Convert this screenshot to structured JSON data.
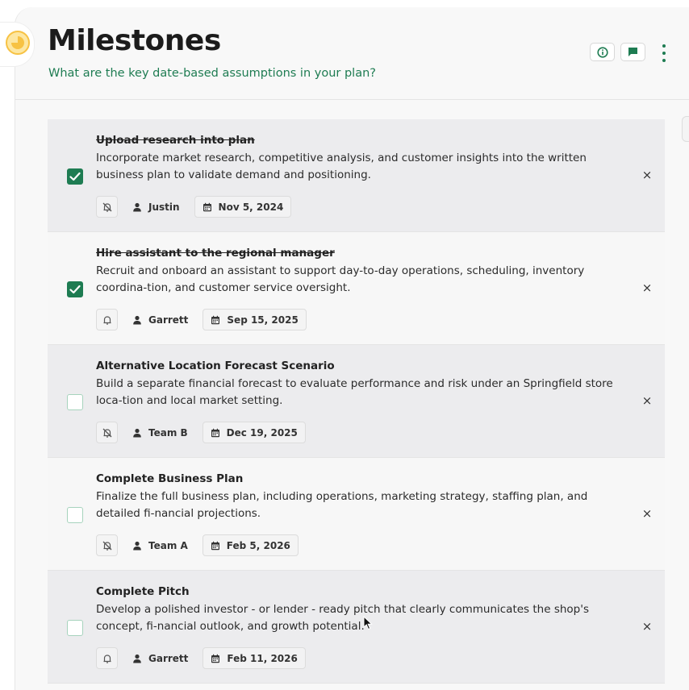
{
  "header": {
    "title": "Milestones",
    "subtitle": "What are the key date-based assumptions in your plan?",
    "info_icon": "info-icon",
    "comment_icon": "comment-icon",
    "menu_icon": "more-vertical-icon",
    "accent_color": "#1e7c52"
  },
  "milestones": [
    {
      "title": "Upload research into plan",
      "description": "Incorporate market research, competitive analysis, and customer insights into the written business plan to validate demand and positioning.",
      "completed": true,
      "reminder": "off",
      "assignee": "Justin",
      "date": "Nov 5, 2024"
    },
    {
      "title": "Hire assistant to the regional manager",
      "description": "Recruit and onboard an assistant to support day-to-day operations, scheduling, inventory coordina-tion, and customer service oversight.",
      "completed": true,
      "reminder": "on",
      "assignee": "Garrett",
      "date": "Sep 15, 2025"
    },
    {
      "title": "Alternative Location Forecast Scenario",
      "description": "Build a separate financial forecast to evaluate performance and risk under an Springfield store loca-tion and local market setting.",
      "completed": false,
      "reminder": "off",
      "assignee": "Team B",
      "date": "Dec 19, 2025"
    },
    {
      "title": "Complete Business Plan",
      "description": "Finalize the full business plan, including operations, marketing strategy, staffing plan, and detailed fi-nancial projections.",
      "completed": false,
      "reminder": "off",
      "assignee": "Team A",
      "date": "Feb 5, 2026"
    },
    {
      "title": "Complete Pitch",
      "description": "Develop a polished investor - or lender - ready pitch that clearly communicates the shop's concept, fi-nancial outlook, and growth potential.",
      "completed": false,
      "reminder": "on",
      "assignee": "Garrett",
      "date": "Feb 11, 2026"
    }
  ],
  "remove_symbol": "×"
}
